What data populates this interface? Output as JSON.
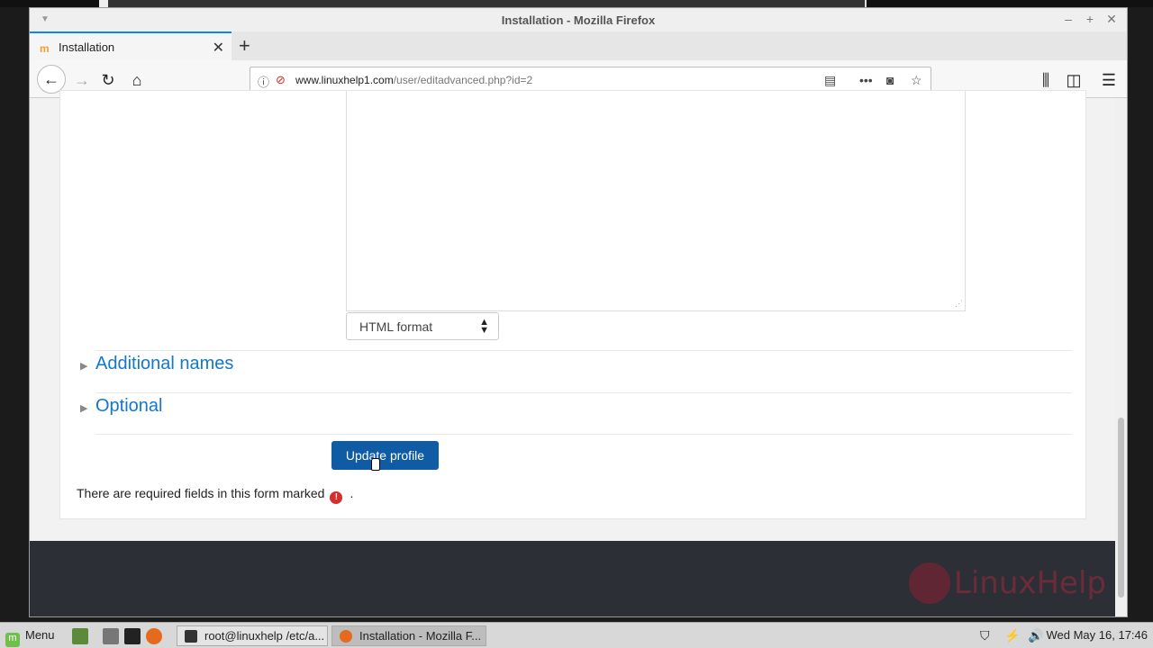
{
  "window": {
    "title": "Installation - Mozilla Firefox",
    "minimize": "–",
    "maximize": "+",
    "close": "✕"
  },
  "tabs": [
    {
      "label": "Installation",
      "favicon": "moodle-icon",
      "active": true
    }
  ],
  "navbar": {
    "url_domain": "www.linuxhelp1.com",
    "url_path": "/user/editadvanced.php?id=2"
  },
  "form": {
    "format_select": "HTML format",
    "sections": [
      {
        "label": "Additional names"
      },
      {
        "label": "Optional"
      }
    ],
    "submit_label": "Update profile",
    "required_note": "There are required fields in this form marked",
    "required_note_end": "."
  },
  "footer": {
    "logo_text": "LinuxHelp"
  },
  "taskbar": {
    "menu_label": "Menu",
    "tasks": [
      {
        "label": "root@linuxhelp /etc/a..."
      },
      {
        "label": "Installation - Mozilla F..."
      }
    ],
    "clock": "Wed May 16, 17:46"
  }
}
